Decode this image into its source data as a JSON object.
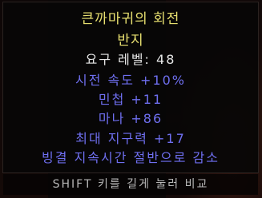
{
  "item": {
    "name_line1": "큰까마귀의 회전",
    "name_line2": "반지",
    "required_level_label": "요구 레벨: 48",
    "properties": [
      "시전 속도 +10%",
      "민첩 +11",
      "마나 +86",
      "최대 지구력 +17",
      "빙결 지속시간 절반으로 감소"
    ]
  },
  "hint": "SHIFT 키를 길게 눌러 비교",
  "colors": {
    "unique_name": "#e8e070",
    "magic_property": "#6f6ff0",
    "requirement": "#e6e6e6"
  }
}
